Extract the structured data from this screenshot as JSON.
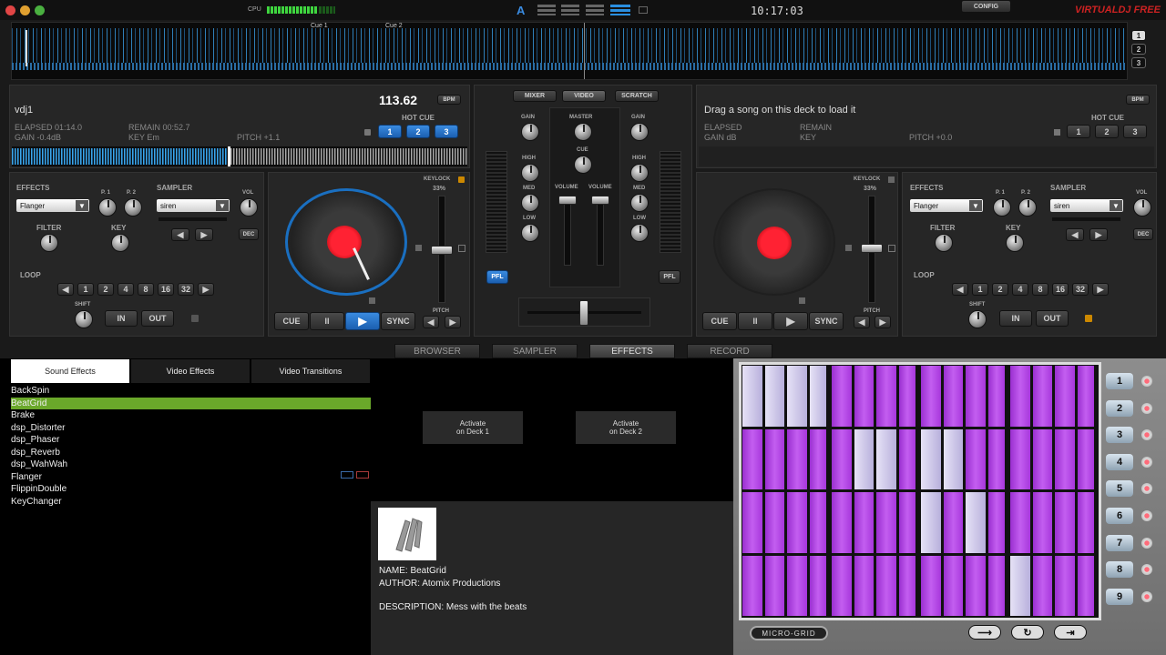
{
  "top": {
    "cpu_label": "CPU",
    "clock": "10:17:03",
    "config_label": "CONFIG",
    "brand": "VIRTUALDJ FREE",
    "cue_markers": [
      "Cue 1",
      "Cue 2"
    ],
    "layout_buttons": [
      "1",
      "2",
      "3"
    ],
    "automix_icon": "A"
  },
  "deck1": {
    "title": "vdj1",
    "bpm": "113.62",
    "bpm_label": "BPM",
    "elapsed": "ELAPSED 01:14.0",
    "remain": "REMAIN 00:52.7",
    "gain": "GAIN -0.4dB",
    "key": "KEY Em",
    "pitch": "PITCH +1.1",
    "hotcue_label": "HOT CUE",
    "hotcues": [
      "1",
      "2",
      "3"
    ],
    "effects_label": "EFFECTS",
    "effect_value": "Flanger",
    "p1": "P. 1",
    "p2": "P. 2",
    "sampler_label": "SAMPLER",
    "sampler_value": "siren",
    "vol": "VOL",
    "filter": "FILTER",
    "key_label": "KEY",
    "dec": "DEC",
    "loop_label": "LOOP",
    "loops": [
      "1",
      "2",
      "4",
      "8",
      "16",
      "32"
    ],
    "shift": "SHIFT",
    "in": "IN",
    "out": "OUT",
    "keylock": "KEYLOCK",
    "keylock_pct": "33%",
    "pitch_label": "PITCH",
    "cue": "CUE",
    "pause": "II",
    "play": "▶",
    "sync": "SYNC"
  },
  "deck2": {
    "title": "Drag a song on this deck to load it",
    "bpm_label": "BPM",
    "elapsed": "ELAPSED",
    "remain": "REMAIN",
    "gain": "GAIN dB",
    "key": "KEY",
    "pitch": "PITCH +0.0",
    "hotcue_label": "HOT CUE",
    "hotcues": [
      "1",
      "2",
      "3"
    ],
    "effects_label": "EFFECTS",
    "effect_value": "Flanger",
    "p1": "P. 1",
    "p2": "P. 2",
    "sampler_label": "SAMPLER",
    "sampler_value": "siren",
    "vol": "VOL",
    "filter": "FILTER",
    "key_label": "KEY",
    "dec": "DEC",
    "loop_label": "LOOP",
    "loops": [
      "1",
      "2",
      "4",
      "8",
      "16",
      "32"
    ],
    "shift": "SHIFT",
    "in": "IN",
    "out": "OUT",
    "keylock": "KEYLOCK",
    "keylock_pct": "33%",
    "pitch_label": "PITCH",
    "cue": "CUE",
    "pause": "II",
    "play": "▶",
    "sync": "SYNC"
  },
  "mixer": {
    "tabs": [
      "MIXER",
      "VIDEO",
      "SCRATCH"
    ],
    "gain": "GAIN",
    "master": "MASTER",
    "cue": "CUE",
    "high": "HIGH",
    "med": "MED",
    "low": "LOW",
    "volume": "VOLUME",
    "pfl": "PFL"
  },
  "bottom_tabs": [
    "BROWSER",
    "SAMPLER",
    "EFFECTS",
    "RECORD"
  ],
  "fx_tabs": [
    "Sound Effects",
    "Video Effects",
    "Video Transitions"
  ],
  "effects": [
    "BackSpin",
    "BeatGrid",
    "Brake",
    "dsp_Distorter",
    "dsp_Phaser",
    "dsp_Reverb",
    "dsp_WahWah",
    "Flanger",
    "FlippinDouble",
    "KeyChanger"
  ],
  "selected_effect_index": 1,
  "activate": {
    "deck1": "Activate\non Deck 1",
    "deck2": "Activate\non Deck 2"
  },
  "info": {
    "name": "NAME: BeatGrid",
    "author": "AUTHOR: Atomix Productions",
    "description": "DESCRIPTION: Mess with the beats"
  },
  "grid": {
    "label": "MICRO-GRID",
    "numbers": [
      "1",
      "2",
      "3",
      "4",
      "5",
      "6",
      "7",
      "8",
      "9"
    ],
    "colors": {
      "purple": "#b23ee6",
      "light": "#d6d0ee",
      "frame": "#a7a7a7"
    }
  },
  "colors": {
    "accent": "#2a8fe0",
    "wave": "#3fa6e6",
    "select": "#6aa82a"
  }
}
